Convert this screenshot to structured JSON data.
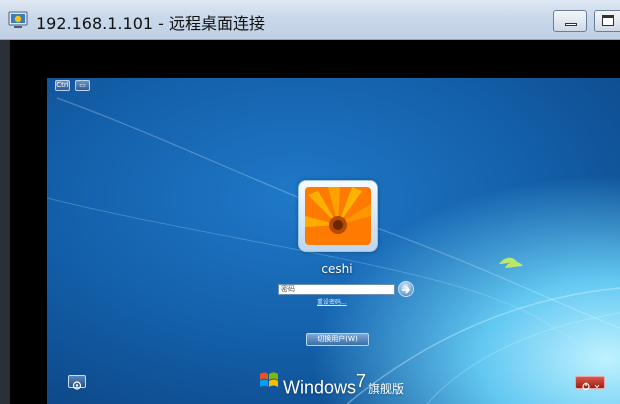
{
  "window": {
    "title": "192.168.1.101 - 远程桌面连接",
    "icon": "remote-desktop-icon",
    "buttons": [
      "minimize-icon",
      "maximize-icon"
    ]
  },
  "login": {
    "corner_buttons": [
      "Ctrl",
      ""
    ],
    "username": "ceshi",
    "password_placeholder": "密码",
    "reset_link": "重设密码...",
    "switch_user_label": "切换用户(W)",
    "ease_of_access_icon": "ease-of-access-icon",
    "shutdown_icon": "power-icon"
  },
  "branding": {
    "windows": "Windows",
    "version": "7",
    "edition": "旗舰版"
  },
  "colors": {
    "titlebar": "#c9d8ea",
    "desktop_blue": "#135ea8",
    "highlight": "#bff2ff",
    "shutdown_red": "#b8322a"
  }
}
